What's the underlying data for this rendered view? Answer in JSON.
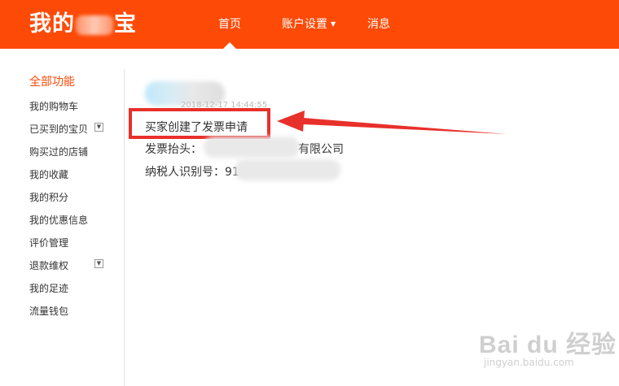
{
  "header": {
    "logo_prefix": "我的",
    "logo_suffix": "宝",
    "nav": [
      {
        "label": "首页"
      },
      {
        "label": "账户设置"
      },
      {
        "label": "消息"
      }
    ]
  },
  "sidebar": {
    "title": "全部功能",
    "items": [
      {
        "label": "我的购物车"
      },
      {
        "label": "已买到的宝贝"
      },
      {
        "label": "购买过的店铺"
      },
      {
        "label": "我的收藏"
      },
      {
        "label": "我的积分"
      },
      {
        "label": "我的优惠信息"
      },
      {
        "label": "评价管理"
      },
      {
        "label": "退款维权"
      },
      {
        "label": "我的足迹"
      },
      {
        "label": "流量钱包"
      }
    ]
  },
  "record": {
    "time": "2018-12-17 14:44:55",
    "event": "买家创建了发票申请",
    "invoice_title_label": "发票抬头：",
    "invoice_title_prefix": "",
    "invoice_title_suffix": "有限公司",
    "taxpayer_id_label": "纳税人识别号：",
    "taxpayer_id_prefix": "91"
  },
  "watermark": {
    "text": "Bai du 经验",
    "url": "jingyan.baidu.com"
  },
  "colors": {
    "brand": "#fd4a07",
    "annotation": "#e8302b"
  }
}
